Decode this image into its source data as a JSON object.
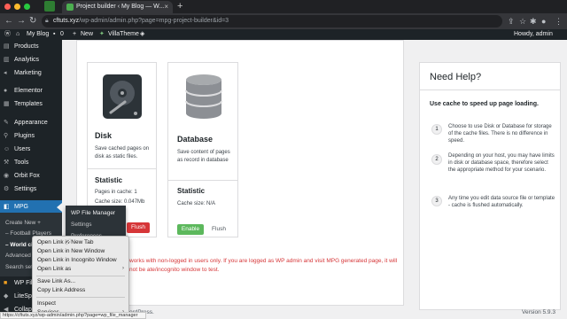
{
  "browser": {
    "tab_title": "Project builder ‹ My Blog — W...",
    "url_host": "cftuts.xyz",
    "url_path": "/wp-admin/admin.php?page=mpg-project-builder&id=3",
    "new_tab_symbol": "+",
    "close_tab_symbol": "×",
    "traffic_light_colors": [
      "#ff5f57",
      "#febc2e",
      "#28c840"
    ]
  },
  "adminbar": {
    "site_name": "My Blog",
    "comments_count": "0",
    "new_label": "New",
    "theme_label": "VillaTheme",
    "howdy": "Howdy, admin"
  },
  "sidebar": {
    "items": [
      {
        "label": "Products",
        "icon": "products-icon"
      },
      {
        "label": "Analytics",
        "icon": "analytics-icon"
      },
      {
        "label": "Marketing",
        "icon": "marketing-icon"
      },
      {
        "label": "Elementor",
        "icon": "elementor-icon"
      },
      {
        "label": "Templates",
        "icon": "templates-icon"
      },
      {
        "label": "Appearance",
        "icon": "appearance-icon"
      },
      {
        "label": "Plugins",
        "icon": "plugins-icon"
      },
      {
        "label": "Users",
        "icon": "users-icon"
      },
      {
        "label": "Tools",
        "icon": "tools-icon"
      },
      {
        "label": "Orbit Fox",
        "icon": "orbit-fox-icon"
      },
      {
        "label": "Settings",
        "icon": "settings-icon"
      },
      {
        "label": "MPG",
        "icon": "mpg-icon"
      }
    ],
    "submenu": [
      "Create New +",
      "– Football Players",
      "– World ci",
      "Advanced c",
      "Search sett"
    ],
    "lower_items": [
      "WP Fil",
      "LiteSp",
      "Collap"
    ]
  },
  "flyout": {
    "items": [
      "WP File Manager",
      "Settings",
      "Preferences"
    ]
  },
  "cache": {
    "disk": {
      "title": "Disk",
      "description": "Save cached pages on disk as static files.",
      "statistic_title": "Statistic",
      "pages_in_cache": "Pages in cache: 1",
      "cache_size": "Cache size: 0.047Mb",
      "flush_label": "Flush"
    },
    "database": {
      "title": "Database",
      "description": "Save content of pages as record in database",
      "statistic_title": "Statistic",
      "cache_size": "Cache size: N/A",
      "enable_label": "Enable",
      "flush_label": "Flush"
    },
    "note": "works with non-logged in users only. If you are logged as WP admin and visit MPG generated page, it will not be ate/incognito window to test."
  },
  "help": {
    "title": "Need Help?",
    "subtitle": "Use cache to speed up page loading.",
    "steps": [
      {
        "num": "1",
        "text": "Choose to use Disk or Database for storage of the cache files. There is no difference in speed."
      },
      {
        "num": "2",
        "text": "Depending on your host, you may have limits in disk or database space, therefore select the appropriate method for your scenario."
      },
      {
        "num": "3",
        "text": "Any time you edit data source file or template - cache is flushed automatically."
      }
    ]
  },
  "footer": {
    "left": "ordPress.",
    "version": "Version 5.9.3"
  },
  "context_menu": {
    "items": [
      "Open Link in New Tab",
      "Open Link in New Window",
      "Open Link in Incognito Window",
      "Open Link as",
      "Save Link As...",
      "Copy Link Address",
      "Inspect",
      "Services"
    ],
    "submenu_arrow": "›"
  },
  "status_url": "https://cftuts.xyz/wp-admin/admin.php?page=wp_file_manager"
}
